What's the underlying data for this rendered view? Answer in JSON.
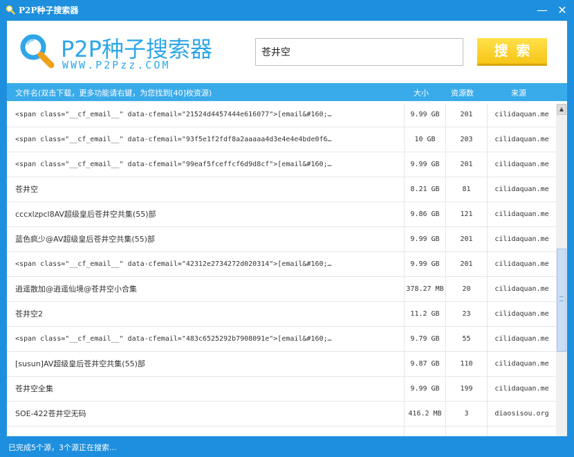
{
  "window": {
    "title": "P2P种子搜索器",
    "minimize_glyph": "—",
    "close_glyph": "✕"
  },
  "logo": {
    "title": "P2P种子搜索器",
    "subtitle": "WWW.P2Pzz.COM",
    "icon": "magnifier-icon"
  },
  "search": {
    "value": "苍井空",
    "button_label": "搜索"
  },
  "columns": {
    "name": "文件名(双击下载，更多功能请右键，为您找到[40]枚资源)",
    "size": "大小",
    "sources": "资源数",
    "origin": "来源"
  },
  "rows": [
    {
      "name": "<span  class=\"__cf_email__\"  data-cfemail=\"21524d4457444e616077\">[email&#160;…",
      "size": "9.99 GB",
      "sources": "201",
      "origin": "cilidaquan.me",
      "code": true
    },
    {
      "name": "<span  class=\"__cf_email__\"  data-cfemail=\"93f5e1f2fdf8a2aaaaa4d3e4e4e4bde0f6…",
      "size": "10 GB",
      "sources": "203",
      "origin": "cilidaquan.me",
      "code": true
    },
    {
      "name": "<span  class=\"__cf_email__\"  data-cfemail=\"99eaf5fceffcf6d9d8cf\">[email&#160;…",
      "size": "9.99 GB",
      "sources": "201",
      "origin": "cilidaquan.me",
      "code": true
    },
    {
      "name": "苍井空",
      "size": "8.21 GB",
      "sources": "81",
      "origin": "cilidaquan.me",
      "code": false
    },
    {
      "name": "cccxlzpcl8AV超级皇后苍井空共集(55)部",
      "size": "9.86 GB",
      "sources": "121",
      "origin": "cilidaquan.me",
      "code": false
    },
    {
      "name": "蓝色疯少@AV超级皇后苍井空共集(55)部",
      "size": "9.99 GB",
      "sources": "201",
      "origin": "cilidaquan.me",
      "code": false
    },
    {
      "name": "<span  class=\"__cf_email__\"  data-cfemail=\"42312e2734272d020314\">[email&#160;…",
      "size": "9.99 GB",
      "sources": "201",
      "origin": "cilidaquan.me",
      "code": true
    },
    {
      "name": "逍遥散加@逍遥仙境@苍井空小合集",
      "size": "378.27 MB",
      "sources": "20",
      "origin": "cilidaquan.me",
      "code": false
    },
    {
      "name": "苍井空2",
      "size": "11.2 GB",
      "sources": "23",
      "origin": "cilidaquan.me",
      "code": false
    },
    {
      "name": "<span  class=\"__cf_email__\"  data-cfemail=\"483c6525292b7908091e\">[email&#160;…",
      "size": "9.79 GB",
      "sources": "55",
      "origin": "cilidaquan.me",
      "code": true
    },
    {
      "name": "[susun]AV超级皇后苍井空共集(55)部",
      "size": "9.87 GB",
      "sources": "110",
      "origin": "cilidaquan.me",
      "code": false
    },
    {
      "name": "苍井空全集",
      "size": "9.99 GB",
      "sources": "199",
      "origin": "cilidaquan.me",
      "code": false
    },
    {
      "name": "SOE-422苍井空无码",
      "size": "416.2 MB",
      "sources": "3",
      "origin": "diaosisou.org",
      "code": false
    },
    {
      "name": "",
      "size": "",
      "sources": "",
      "origin": "",
      "code": false
    }
  ],
  "scrollbar": {
    "up_glyph": "▲",
    "position": 0.5
  },
  "status": {
    "text": "已完成5个源，3个源正在搜索..."
  },
  "colors": {
    "chrome": "#1d8fde",
    "header_bar": "#3aabea",
    "search_button": "#f7c516",
    "logo": "#2ea6e8"
  }
}
